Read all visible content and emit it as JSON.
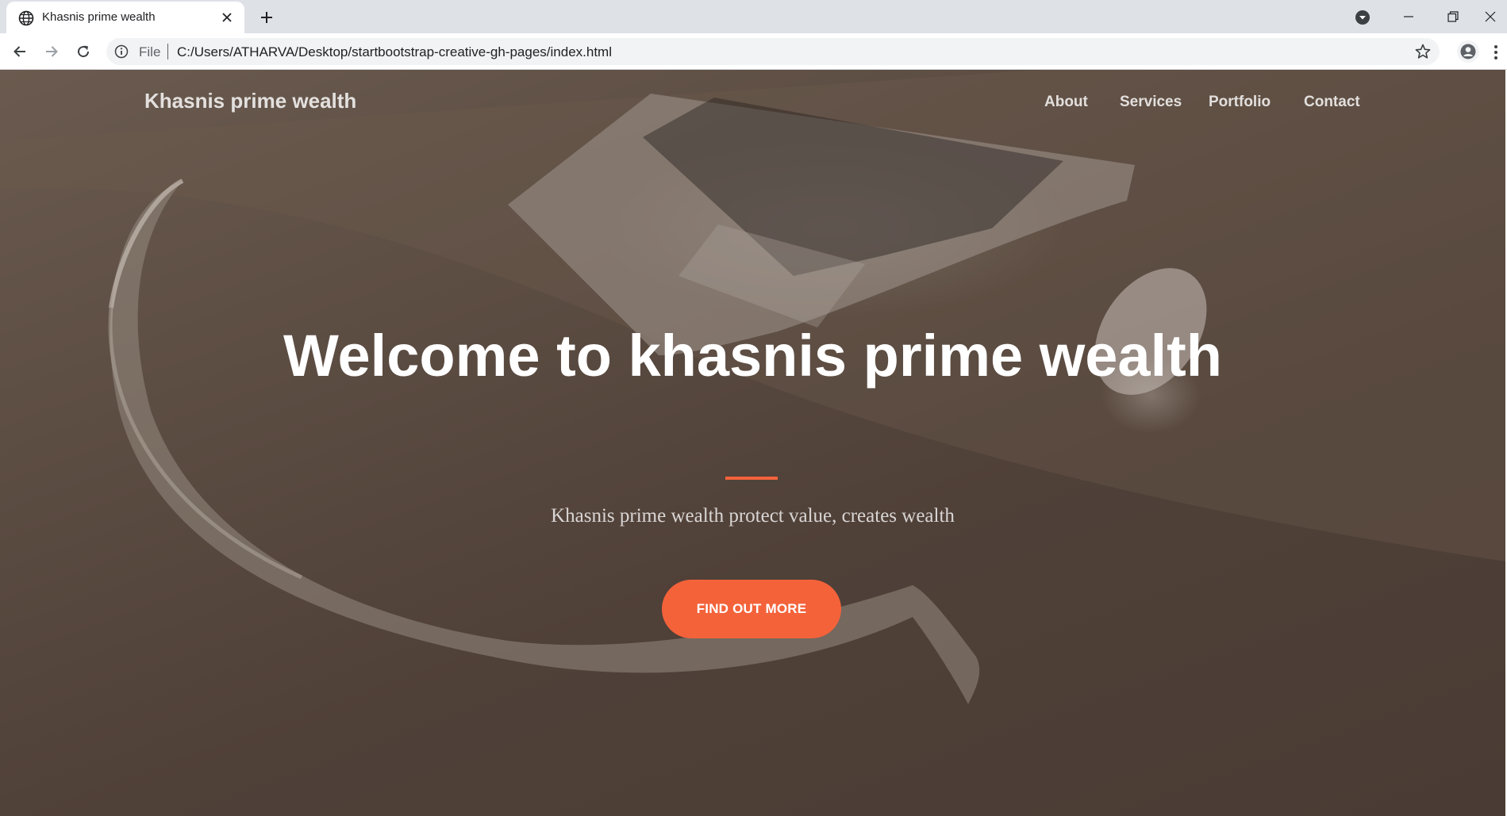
{
  "browser": {
    "tab_title": "Khasnis prime wealth",
    "address_scheme": "File",
    "address_url": "C:/Users/ATHARVA/Desktop/startbootstrap-creative-gh-pages/index.html"
  },
  "site": {
    "brand": "Khasnis prime wealth",
    "nav": {
      "about": "About",
      "services": "Services",
      "portfolio": "Portfolio",
      "contact": "Contact"
    }
  },
  "hero": {
    "title": "Welcome to khasnis prime wealth",
    "subtitle": "Khasnis prime wealth protect value, creates wealth",
    "cta_label": "FIND OUT MORE"
  },
  "colors": {
    "accent": "#f4623a",
    "overlay": "#4f4038",
    "tabbar": "#dee1e6",
    "omnibox": "#f1f3f4"
  },
  "icons": {
    "tab": "globe-icon",
    "close": "close-icon",
    "new_tab": "plus-icon",
    "tab_search": "tab-search-icon",
    "minimize": "minimize-icon",
    "restore": "restore-icon",
    "window_close": "window-close-icon",
    "back": "back-arrow-icon",
    "forward": "forward-arrow-icon",
    "reload": "reload-icon",
    "info": "info-icon",
    "bookmark": "star-icon",
    "profile": "profile-icon",
    "menu": "kebab-menu-icon"
  }
}
